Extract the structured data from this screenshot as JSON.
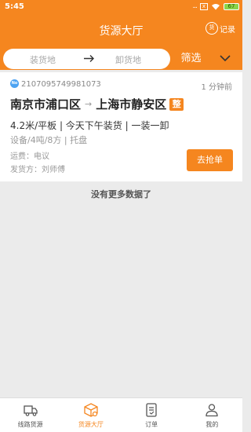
{
  "status_bar": {
    "time": "5:45",
    "dots": "...",
    "box_label": "x",
    "battery": "67"
  },
  "header": {
    "title": "货源大厅",
    "record_icon_text": "货",
    "record_label": "记录"
  },
  "filter": {
    "load_place": "装货地",
    "unload_place": "卸货地",
    "screen_label": "筛选"
  },
  "order": {
    "no_badge": "No",
    "number": "2107095749981073",
    "time_ago": "1 分钟前",
    "from": "南京市浦口区",
    "arrow": "→",
    "to": "上海市静安区",
    "type_badge": "整",
    "spec_line": "4.2米/平板 | 今天下午装货 | 一装一卸",
    "detail_line": "设备/4吨/8方 | 托盘",
    "freight": "运费：电议",
    "shipper": "发货方：刘师傅",
    "grab_label": "去抢单"
  },
  "no_more": "没有更多数据了",
  "tabs": [
    {
      "label": "线路货源",
      "icon": "truck-icon"
    },
    {
      "label": "货源大厅",
      "icon": "package-icon"
    },
    {
      "label": "订单",
      "icon": "order-icon"
    },
    {
      "label": "我的",
      "icon": "user-icon"
    }
  ],
  "colors": {
    "brand": "#f5861f",
    "badge_blue": "#4da3f2"
  }
}
